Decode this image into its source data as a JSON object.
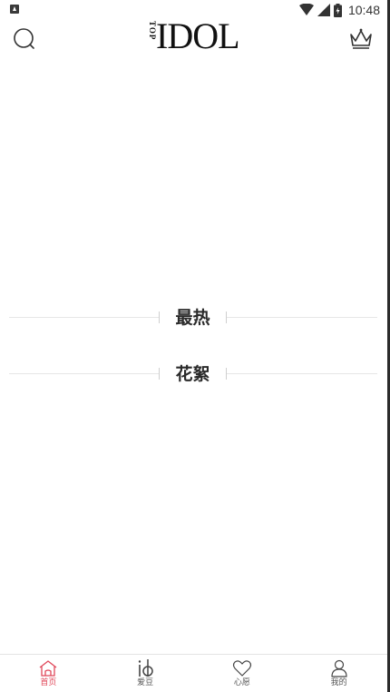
{
  "status_bar": {
    "time": "10:48"
  },
  "header": {
    "logo_text": "IDOL",
    "logo_rot_text": "TOP"
  },
  "sections": [
    {
      "title": "最热"
    },
    {
      "title": "花絮"
    }
  ],
  "bottom_nav": {
    "items": [
      {
        "label": "首页",
        "icon": "home-icon",
        "active": true
      },
      {
        "label": "爱豆",
        "icon": "idol-icon",
        "active": false
      },
      {
        "label": "心愿",
        "icon": "heart-icon",
        "active": false
      },
      {
        "label": "我的",
        "icon": "profile-icon",
        "active": false
      }
    ]
  },
  "colors": {
    "active": "#e0485a",
    "inactive": "#555555"
  }
}
